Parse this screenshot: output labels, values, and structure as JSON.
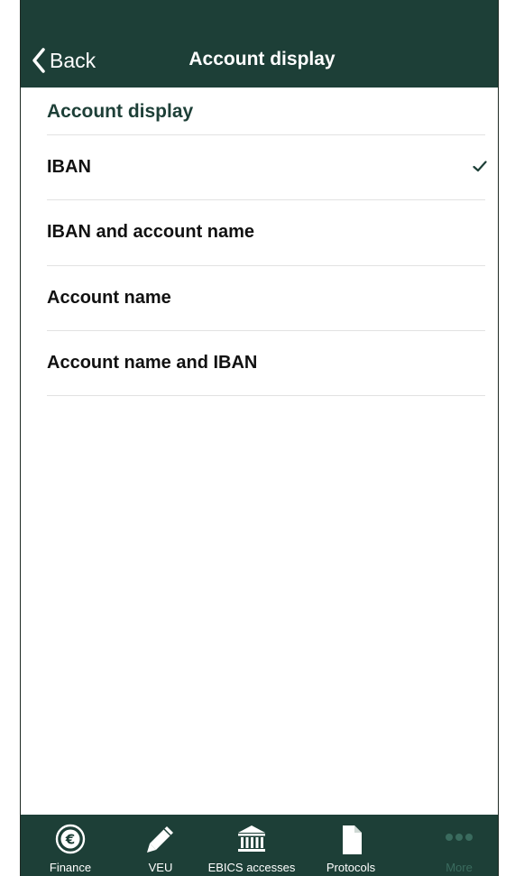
{
  "nav": {
    "back_label": "Back",
    "title": "Account display"
  },
  "section": {
    "header": "Account display"
  },
  "options": [
    {
      "label": "IBAN",
      "selected": true
    },
    {
      "label": "IBAN and account name",
      "selected": false
    },
    {
      "label": "Account name",
      "selected": false
    },
    {
      "label": "Account name and IBAN",
      "selected": false
    }
  ],
  "tabs": [
    {
      "label": "Finance",
      "icon": "euro-icon"
    },
    {
      "label": "VEU",
      "icon": "pen-icon"
    },
    {
      "label": "EBICS accesses",
      "icon": "bank-icon"
    },
    {
      "label": "Protocols",
      "icon": "document-icon"
    },
    {
      "label": "More",
      "icon": "more-dots-icon"
    }
  ],
  "colors": {
    "brand": "#1d3f37",
    "check": "#1d3f37",
    "inactive_tab": "#3a6b5e"
  }
}
